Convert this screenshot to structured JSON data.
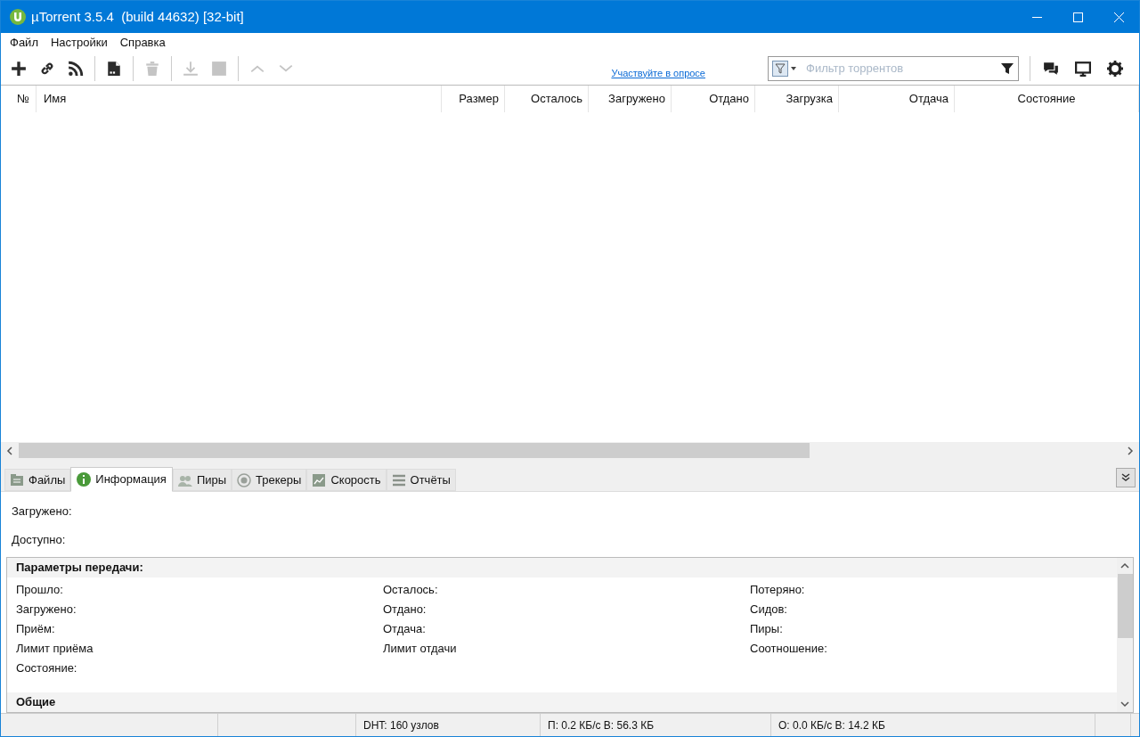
{
  "window": {
    "title": "µTorrent 3.5.4  (build 44632) [32-bit]"
  },
  "menu": [
    "Файл",
    "Настройки",
    "Справка"
  ],
  "toolbar": {
    "buttons": [
      {
        "kind": "add",
        "disabled": false
      },
      {
        "kind": "link",
        "disabled": false
      },
      {
        "kind": "rss",
        "disabled": false
      },
      {
        "kind": "sep"
      },
      {
        "kind": "create",
        "disabled": false
      },
      {
        "kind": "sep"
      },
      {
        "kind": "delete",
        "disabled": true
      },
      {
        "kind": "sep"
      },
      {
        "kind": "download",
        "disabled": true
      },
      {
        "kind": "stop",
        "disabled": true
      },
      {
        "kind": "sep"
      },
      {
        "kind": "up",
        "disabled": true
      },
      {
        "kind": "down",
        "disabled": true
      }
    ],
    "survey_link": "Участвуйте в опросе",
    "filter": {
      "placeholder": "Фильтр торрентов"
    }
  },
  "table": {
    "columns": [
      "№",
      "Имя",
      "Размер",
      "Осталось",
      "Загружено",
      "Отдано",
      "Загрузка",
      "Отдача",
      "Состояние"
    ]
  },
  "tabs": [
    {
      "label": "Файлы",
      "selected": false
    },
    {
      "label": "Информация",
      "selected": true
    },
    {
      "label": "Пиры",
      "selected": false
    },
    {
      "label": "Трекеры",
      "selected": false
    },
    {
      "label": "Скорость",
      "selected": false
    },
    {
      "label": "Отчёты",
      "selected": false
    }
  ],
  "info": [
    "Загружено:",
    "Доступно:"
  ],
  "transfer": {
    "heading": "Параметры передачи:",
    "columns": [
      [
        "Прошло:",
        "Загружено:",
        "Приём:",
        "Лимит приёма",
        "Состояние:"
      ],
      [
        "Осталось:",
        "Отдано:",
        "Отдача:",
        "Лимит отдачи"
      ],
      [
        "Потеряно:",
        "Сидов:",
        "Пиры:",
        "Соотношение:"
      ]
    ]
  },
  "general": {
    "heading": "Общие"
  },
  "status_bar": [
    "DHT: 160 узлов",
    "П: 0.2 КБ/с В: 56.3 КБ",
    "О: 0.0 КБ/с В: 14.2 КБ"
  ]
}
